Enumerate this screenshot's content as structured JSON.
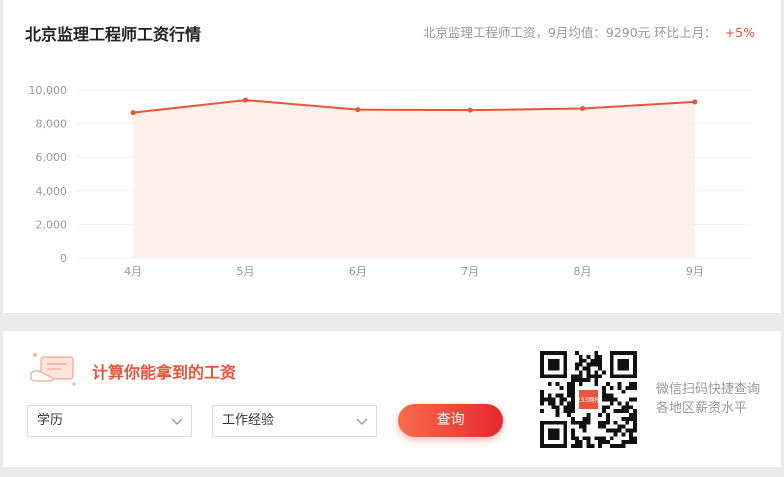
{
  "header": {
    "title": "北京监理工程师工资行情",
    "summary": "北京监理工程师工资，9月均值：9290元 环比上月：",
    "change": "+5%"
  },
  "chart_data": {
    "type": "area",
    "categories": [
      "4月",
      "5月",
      "6月",
      "7月",
      "8月",
      "9月"
    ],
    "values": [
      8650,
      9400,
      8830,
      8800,
      8900,
      9290
    ],
    "yticks": [
      "0",
      "2,000",
      "4,000",
      "6,000",
      "8,000",
      "10,000"
    ],
    "ylim": [
      0,
      10000
    ],
    "grid": true,
    "color": "#e8553b",
    "fill": "#fdefe8"
  },
  "calculator": {
    "title": "计算你能拿到的工资",
    "education": "学历",
    "experience": "工作经验",
    "query": "查询"
  },
  "qr": {
    "badge": "233网校",
    "line1": "微信扫码快捷查询",
    "line2": "各地区薪资水平"
  }
}
